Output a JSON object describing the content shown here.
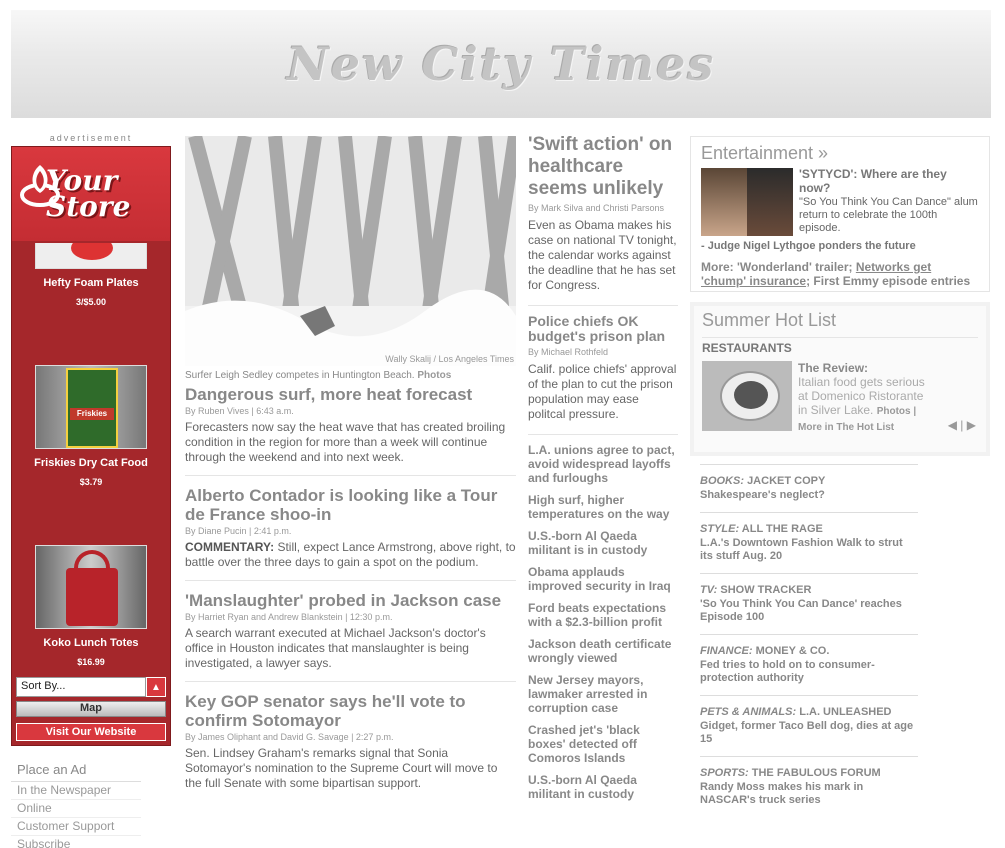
{
  "masthead": {
    "title": "New City Times"
  },
  "ad": {
    "label": "advertisement",
    "logo": "Your Store",
    "products": [
      {
        "name": "Hefty Foam Plates",
        "price": "3/$5.00"
      },
      {
        "name": "Friskies Dry Cat Food",
        "price": "$3.79"
      },
      {
        "name": "Koko Lunch Totes",
        "price": "$16.99"
      }
    ],
    "sort_label": "Sort By...",
    "map_label": "Map",
    "visit_label": "Visit Our Website"
  },
  "place_ad": {
    "title": "Place an Ad",
    "links": [
      "In the Newspaper",
      "Online",
      "Customer Support",
      "Subscribe"
    ]
  },
  "main": {
    "photo_credit": "Wally Skalij / Los Angeles Times",
    "photo_caption": "Surfer Leigh Sedley competes in Huntington Beach.",
    "photo_link": "Photos",
    "stories": [
      {
        "title": "Dangerous surf, more heat forecast",
        "byline": "By Ruben Vives | 6:43 a.m.",
        "kicker": "",
        "body": "Forecasters now say the heat wave that has created broiling condition in the region for more than a week will continue through the weekend and into next week."
      },
      {
        "title": "Alberto Contador is looking like a Tour de France shoo-in",
        "byline": "By Diane Pucin | 2:41 p.m.",
        "kicker": "COMMENTARY:",
        "body": "Still, expect Lance Armstrong, above right, to battle over the three days to gain a spot on the podium."
      },
      {
        "title": "'Manslaughter' probed in Jackson case",
        "byline": "By Harriet Ryan and Andrew Blankstein | 12:30 p.m.",
        "kicker": "",
        "body": "A search warrant executed at Michael Jackson's doctor's office in Houston indicates that manslaughter is being investigated, a lawyer says."
      },
      {
        "title": "Key GOP senator says he'll vote to confirm Sotomayor",
        "byline": "By James Oliphant and David G. Savage | 2:27 p.m.",
        "kicker": "",
        "body": "Sen. Lindsey Graham's remarks signal that Sonia Sotomayor's nomination to the Supreme Court will move to the full Senate with some bipartisan support."
      }
    ]
  },
  "col2": {
    "lead": {
      "title": "'Swift action' on healthcare seems unlikely",
      "byline": "By Mark Silva and Christi Parsons",
      "body": "Even as Obama makes his case on national TV tonight, the calendar works against the deadline that he has set for Congress."
    },
    "sub": {
      "title": "Police chiefs OK budget's prison plan",
      "byline": "By Michael Rothfeld",
      "body": "Calif. police chiefs' approval of the plan to cut the prison population may ease politcal pressure."
    },
    "headlines": [
      "L.A. unions agree to pact, avoid widespread layoffs and furloughs",
      "High surf, higher temperatures on the way",
      "U.S.-born Al Qaeda militant is in custody",
      "Obama applauds improved security in Iraq",
      "Ford beats expectations with a $2.3-billion profit",
      "Jackson death certificate wrongly viewed",
      "New Jersey mayors, lawmaker arrested in corruption case",
      "Crashed jet's 'black boxes' detected off Comoros Islands",
      "U.S.-born Al Qaeda militant in custody"
    ]
  },
  "entertainment": {
    "title": "Entertainment »",
    "headline": "'SYTYCD': Where are they now?",
    "body": "\"So You Think You Can Dance\" alum return to celebrate the 100th episode.",
    "quote": "- Judge Nigel Lythgoe ponders the future",
    "more_prefix": "More: 'Wonderland' trailer;",
    "more_link": "Networks get 'chump' insurance",
    "more_suffix": "; First Emmy episode entries"
  },
  "hot_list": {
    "title": "Summer Hot List",
    "category": "RESTAURANTS",
    "headline": "The Review:",
    "body": "Italian food gets serious at Domenico Ristorante in Silver Lake.",
    "photos_link": "Photos |",
    "more_link": "More in The Hot List"
  },
  "sections": [
    {
      "section": "BOOKS:",
      "column": "JACKET COPY",
      "desc": "Shakespeare's neglect?"
    },
    {
      "section": "STYLE:",
      "column": "ALL THE RAGE",
      "desc": "L.A.'s Downtown Fashion Walk to strut its stuff Aug. 20"
    },
    {
      "section": "TV:",
      "column": "SHOW TRACKER",
      "desc": "'So You Think You Can Dance' reaches Episode 100"
    },
    {
      "section": "FINANCE:",
      "column": "MONEY & CO.",
      "desc": "Fed tries to hold on to consumer-protection authority"
    },
    {
      "section": "PETS & ANIMALS:",
      "column": "L.A. UNLEASHED",
      "desc": "Gidget, former Taco Bell dog, dies at age 15"
    },
    {
      "section": "SPORTS:",
      "column": "THE FABULOUS FORUM",
      "desc": "Randy Moss makes his mark in NASCAR's truck series"
    }
  ]
}
